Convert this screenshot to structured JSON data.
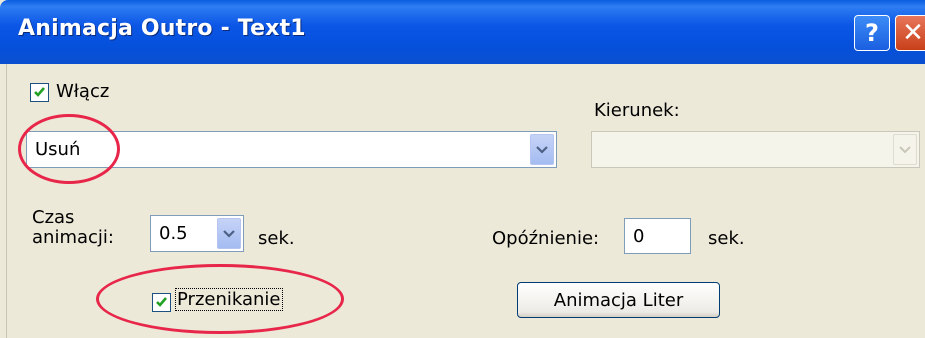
{
  "window": {
    "title": "Animacja Outro - Text1",
    "help_glyph": "?",
    "close_glyph": "✕"
  },
  "enable": {
    "label": "Włącz",
    "checked": true
  },
  "effect": {
    "value": "Usuń"
  },
  "direction": {
    "label": "Kierunek:",
    "value": ""
  },
  "duration": {
    "label_line1": "Czas",
    "label_line2": "animacji:",
    "value": "0.5",
    "unit": "sek."
  },
  "delay": {
    "label": "Opóźnienie:",
    "value": "0",
    "unit": "sek."
  },
  "fade": {
    "label": "Przenikanie",
    "checked": true
  },
  "letters_button": {
    "label": "Animacja Liter"
  },
  "colors": {
    "annotation": "#e8264a",
    "titlebar": "#0551dc"
  }
}
